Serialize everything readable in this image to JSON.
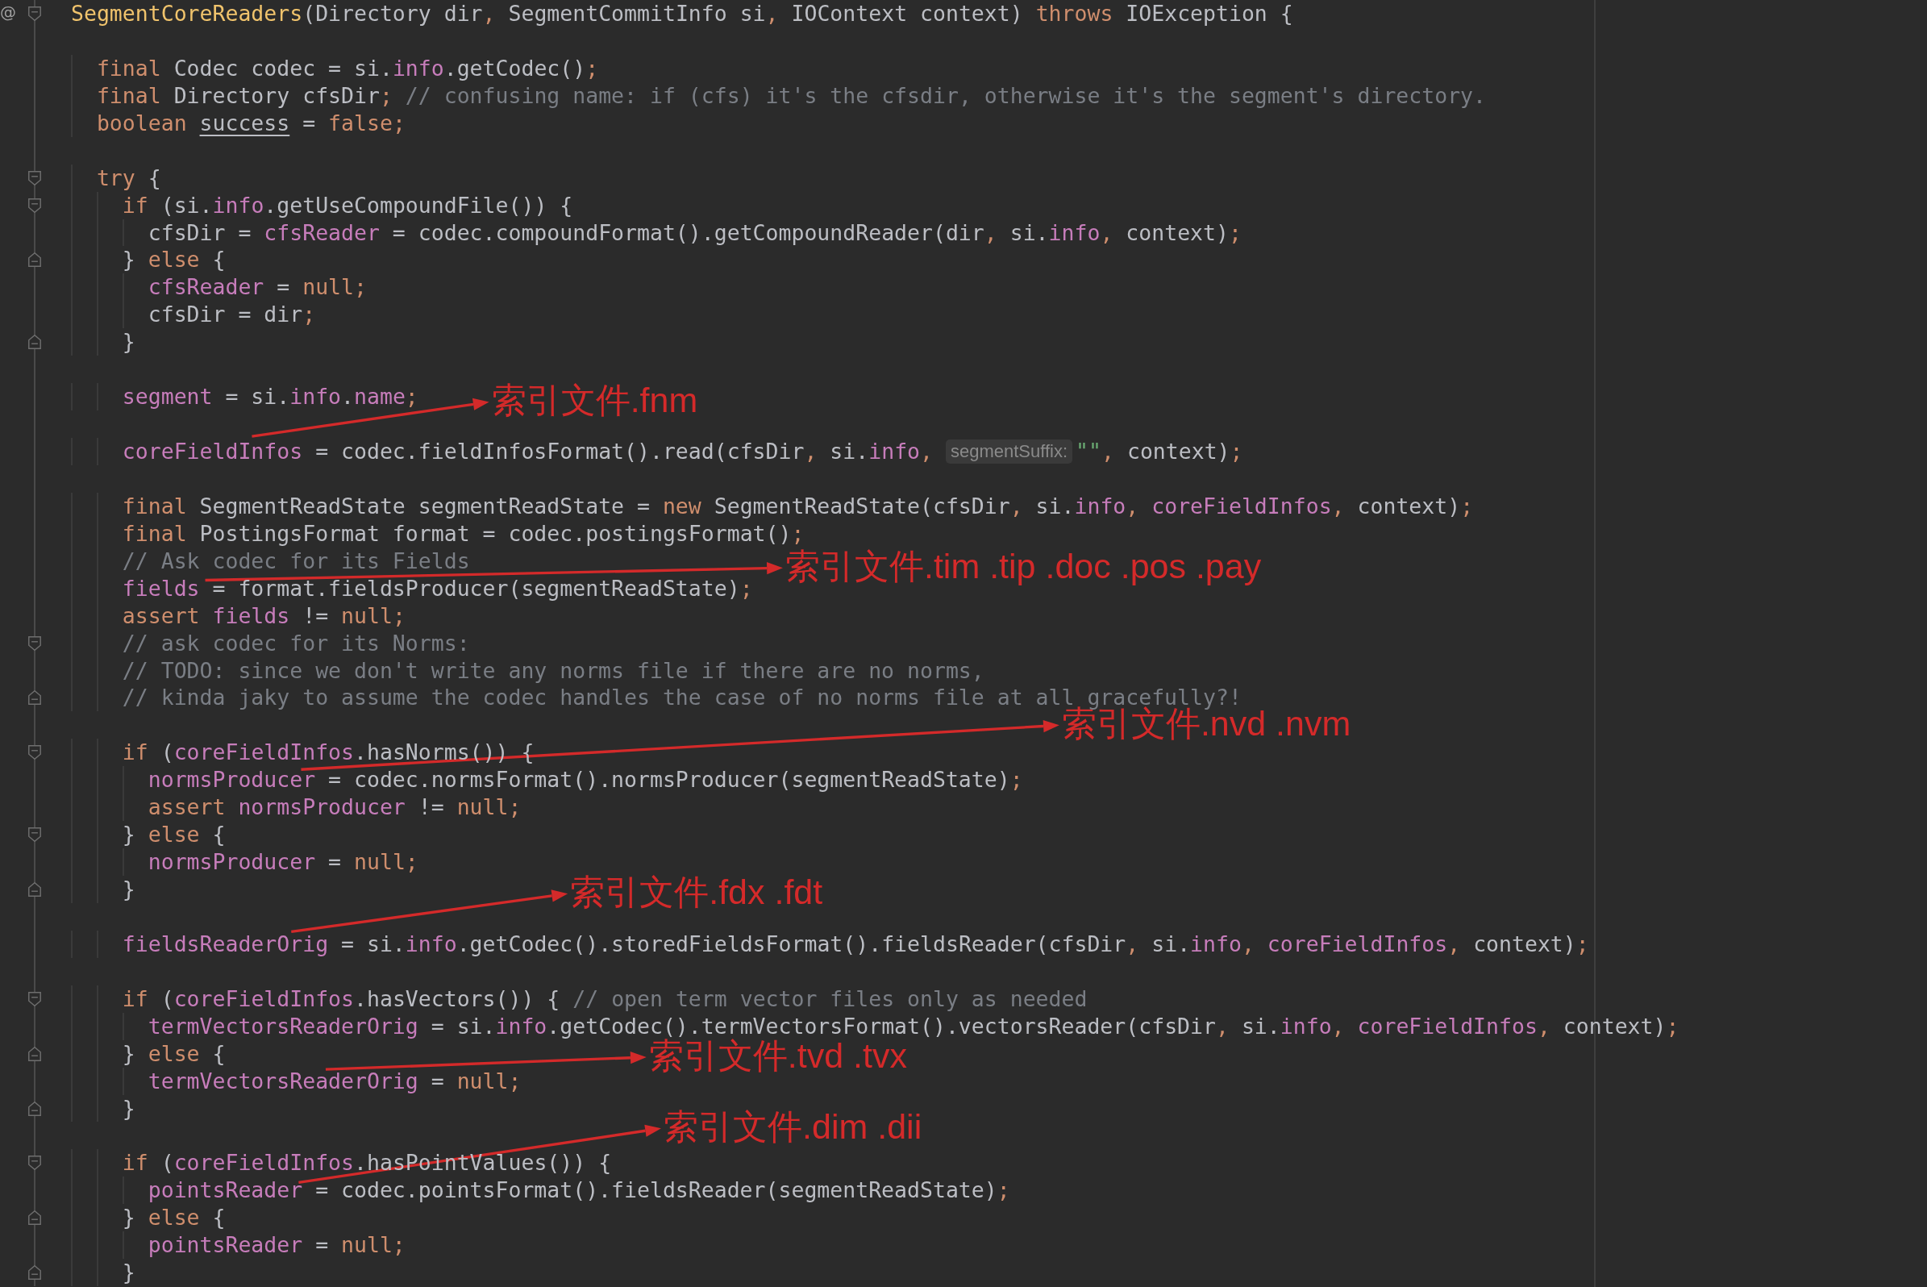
{
  "editor": {
    "lines": [
      {
        "kind": "code",
        "gutter_mark": "@",
        "fold_marker": {
          "kind": "start"
        },
        "tokens": [
          {
            "text": "SegmentCoreReaders",
            "kind": "method"
          },
          {
            "text": "(Directory dir",
            "kind": "plain"
          },
          {
            "text": ", ",
            "kind": "punct"
          },
          {
            "text": "SegmentCommitInfo si",
            "kind": "plain"
          },
          {
            "text": ", ",
            "kind": "punct"
          },
          {
            "text": "IOContext context) ",
            "kind": "plain"
          },
          {
            "text": "throws",
            "kind": "keyword"
          },
          {
            "text": " IOException {",
            "kind": "plain"
          }
        ]
      },
      {
        "kind": "blank"
      },
      {
        "kind": "code",
        "tokens": [
          {
            "text": "  final",
            "kind": "keyword"
          },
          {
            "text": " Codec codec = si.",
            "kind": "plain"
          },
          {
            "text": "info",
            "kind": "field"
          },
          {
            "text": ".getCodec()",
            "kind": "plain"
          },
          {
            "text": ";",
            "kind": "punct"
          }
        ]
      },
      {
        "kind": "code",
        "tokens": [
          {
            "text": "  final",
            "kind": "keyword"
          },
          {
            "text": " Directory cfsDir",
            "kind": "plain"
          },
          {
            "text": ";",
            "kind": "punct"
          },
          {
            "text": " // confusing name: if (cfs) it's the cfsdir, otherwise it's the segment's directory.",
            "kind": "comment"
          }
        ]
      },
      {
        "kind": "code",
        "tokens": [
          {
            "text": "  boolean ",
            "kind": "keyword"
          },
          {
            "text": "success",
            "kind": "underlined"
          },
          {
            "text": " = ",
            "kind": "plain"
          },
          {
            "text": "false;",
            "kind": "keyword"
          }
        ]
      },
      {
        "kind": "blank"
      },
      {
        "kind": "code",
        "fold_marker": {
          "kind": "start"
        },
        "tokens": [
          {
            "text": "  try",
            "kind": "keyword"
          },
          {
            "text": " {",
            "kind": "plain"
          }
        ]
      },
      {
        "kind": "code",
        "fold_marker": {
          "kind": "start"
        },
        "tokens": [
          {
            "text": "    if",
            "kind": "keyword"
          },
          {
            "text": " (si.",
            "kind": "plain"
          },
          {
            "text": "info",
            "kind": "field"
          },
          {
            "text": ".getUseCompoundFile()) {",
            "kind": "plain"
          }
        ]
      },
      {
        "kind": "code",
        "tokens": [
          {
            "text": "      cfsDir = ",
            "kind": "plain"
          },
          {
            "text": "cfsReader",
            "kind": "field"
          },
          {
            "text": " = codec.compoundFormat().getCompoundReader(dir",
            "kind": "plain"
          },
          {
            "text": ", ",
            "kind": "punct"
          },
          {
            "text": "si.",
            "kind": "plain"
          },
          {
            "text": "info",
            "kind": "field"
          },
          {
            "text": ", ",
            "kind": "punct"
          },
          {
            "text": "context)",
            "kind": "plain"
          },
          {
            "text": ";",
            "kind": "punct"
          }
        ]
      },
      {
        "kind": "code",
        "fold_marker": {
          "kind": "end"
        },
        "tokens": [
          {
            "text": "    } ",
            "kind": "plain"
          },
          {
            "text": "else",
            "kind": "keyword"
          },
          {
            "text": " {",
            "kind": "plain"
          }
        ]
      },
      {
        "kind": "code",
        "tokens": [
          {
            "text": "      cfsReader",
            "kind": "field"
          },
          {
            "text": " = ",
            "kind": "plain"
          },
          {
            "text": "null;",
            "kind": "keyword"
          }
        ]
      },
      {
        "kind": "code",
        "tokens": [
          {
            "text": "      cfsDir = dir",
            "kind": "plain"
          },
          {
            "text": ";",
            "kind": "punct"
          }
        ]
      },
      {
        "kind": "code",
        "fold_marker": {
          "kind": "end"
        },
        "tokens": [
          {
            "text": "    }",
            "kind": "plain"
          }
        ]
      },
      {
        "kind": "blank"
      },
      {
        "kind": "code",
        "tokens": [
          {
            "text": "    segment",
            "kind": "field"
          },
          {
            "text": " = si.",
            "kind": "plain"
          },
          {
            "text": "info",
            "kind": "field"
          },
          {
            "text": ".",
            "kind": "plain"
          },
          {
            "text": "name",
            "kind": "field"
          },
          {
            "text": ";",
            "kind": "punct"
          }
        ]
      },
      {
        "kind": "blank"
      },
      {
        "kind": "code",
        "tokens": [
          {
            "text": "    coreFieldInfos",
            "kind": "field"
          },
          {
            "text": " = codec.fieldInfosFormat().read(cfsDir",
            "kind": "plain"
          },
          {
            "text": ", ",
            "kind": "punct"
          },
          {
            "text": "si.",
            "kind": "plain"
          },
          {
            "text": "info",
            "kind": "field"
          },
          {
            "text": ", ",
            "kind": "punct"
          },
          {
            "text": "segmentSuffix:",
            "kind": "hint"
          },
          {
            "text": "\"\"",
            "kind": "string"
          },
          {
            "text": ", ",
            "kind": "punct"
          },
          {
            "text": "context)",
            "kind": "plain"
          },
          {
            "text": ";",
            "kind": "punct"
          }
        ]
      },
      {
        "kind": "blank"
      },
      {
        "kind": "code",
        "tokens": [
          {
            "text": "    final",
            "kind": "keyword"
          },
          {
            "text": " SegmentReadState segmentReadState = ",
            "kind": "plain"
          },
          {
            "text": "new",
            "kind": "keyword"
          },
          {
            "text": " SegmentReadState(cfsDir",
            "kind": "plain"
          },
          {
            "text": ", ",
            "kind": "punct"
          },
          {
            "text": "si.",
            "kind": "plain"
          },
          {
            "text": "info",
            "kind": "field"
          },
          {
            "text": ", ",
            "kind": "punct"
          },
          {
            "text": "coreFieldInfos",
            "kind": "field"
          },
          {
            "text": ", ",
            "kind": "punct"
          },
          {
            "text": "context)",
            "kind": "plain"
          },
          {
            "text": ";",
            "kind": "punct"
          }
        ]
      },
      {
        "kind": "code",
        "tokens": [
          {
            "text": "    final",
            "kind": "keyword"
          },
          {
            "text": " PostingsFormat format = codec.postingsFormat()",
            "kind": "plain"
          },
          {
            "text": ";",
            "kind": "punct"
          }
        ]
      },
      {
        "kind": "code",
        "tokens": [
          {
            "text": "    // Ask codec for its Fields",
            "kind": "comment"
          }
        ]
      },
      {
        "kind": "code",
        "tokens": [
          {
            "text": "    fields",
            "kind": "field"
          },
          {
            "text": " = format.fieldsProducer(segmentReadState)",
            "kind": "plain"
          },
          {
            "text": ";",
            "kind": "punct"
          }
        ]
      },
      {
        "kind": "code",
        "tokens": [
          {
            "text": "    assert ",
            "kind": "keyword"
          },
          {
            "text": "fields",
            "kind": "field"
          },
          {
            "text": " != ",
            "kind": "plain"
          },
          {
            "text": "null;",
            "kind": "keyword"
          }
        ]
      },
      {
        "kind": "code",
        "fold_marker": {
          "kind": "start"
        },
        "tokens": [
          {
            "text": "    // ask codec for its Norms:",
            "kind": "comment"
          }
        ]
      },
      {
        "kind": "code",
        "tokens": [
          {
            "text": "    // TODO: since we don't write any norms file if there are no norms,",
            "kind": "comment"
          }
        ]
      },
      {
        "kind": "code",
        "fold_marker": {
          "kind": "end"
        },
        "tokens": [
          {
            "text": "    // kinda jaky to assume the codec handles the case of no norms file at all gracefully?!",
            "kind": "comment"
          }
        ]
      },
      {
        "kind": "blank"
      },
      {
        "kind": "code",
        "fold_marker": {
          "kind": "start"
        },
        "tokens": [
          {
            "text": "    if",
            "kind": "keyword"
          },
          {
            "text": " (",
            "kind": "plain"
          },
          {
            "text": "coreFieldInfos",
            "kind": "field"
          },
          {
            "text": ".hasNorms()) {",
            "kind": "plain"
          }
        ]
      },
      {
        "kind": "code",
        "tokens": [
          {
            "text": "      normsProducer",
            "kind": "field"
          },
          {
            "text": " = codec.normsFormat().normsProducer(segmentReadState)",
            "kind": "plain"
          },
          {
            "text": ";",
            "kind": "punct"
          }
        ]
      },
      {
        "kind": "code",
        "tokens": [
          {
            "text": "      assert ",
            "kind": "keyword"
          },
          {
            "text": "normsProducer",
            "kind": "field"
          },
          {
            "text": " != ",
            "kind": "plain"
          },
          {
            "text": "null;",
            "kind": "keyword"
          }
        ]
      },
      {
        "kind": "code",
        "fold_marker": {
          "kind": "start"
        },
        "tokens": [
          {
            "text": "    } ",
            "kind": "plain"
          },
          {
            "text": "else",
            "kind": "keyword"
          },
          {
            "text": " {",
            "kind": "plain"
          }
        ]
      },
      {
        "kind": "code",
        "tokens": [
          {
            "text": "      normsProducer",
            "kind": "field"
          },
          {
            "text": " = ",
            "kind": "plain"
          },
          {
            "text": "null;",
            "kind": "keyword"
          }
        ]
      },
      {
        "kind": "code",
        "fold_marker": {
          "kind": "end"
        },
        "tokens": [
          {
            "text": "    }",
            "kind": "plain"
          }
        ]
      },
      {
        "kind": "blank"
      },
      {
        "kind": "code",
        "tokens": [
          {
            "text": "    fieldsReaderOrig",
            "kind": "field"
          },
          {
            "text": " = si.",
            "kind": "plain"
          },
          {
            "text": "info",
            "kind": "field"
          },
          {
            "text": ".getCodec().storedFieldsFormat().fieldsReader(cfsDir",
            "kind": "plain"
          },
          {
            "text": ", ",
            "kind": "punct"
          },
          {
            "text": "si.",
            "kind": "plain"
          },
          {
            "text": "info",
            "kind": "field"
          },
          {
            "text": ", ",
            "kind": "punct"
          },
          {
            "text": "coreFieldInfos",
            "kind": "field"
          },
          {
            "text": ", ",
            "kind": "punct"
          },
          {
            "text": "context)",
            "kind": "plain"
          },
          {
            "text": ";",
            "kind": "punct"
          }
        ]
      },
      {
        "kind": "blank"
      },
      {
        "kind": "code",
        "fold_marker": {
          "kind": "start"
        },
        "tokens": [
          {
            "text": "    if",
            "kind": "keyword"
          },
          {
            "text": " (",
            "kind": "plain"
          },
          {
            "text": "coreFieldInfos",
            "kind": "field"
          },
          {
            "text": ".hasVectors()) { ",
            "kind": "plain"
          },
          {
            "text": "// open term vector files only as needed",
            "kind": "comment"
          }
        ]
      },
      {
        "kind": "code",
        "tokens": [
          {
            "text": "      termVectorsReaderOrig",
            "kind": "field"
          },
          {
            "text": " = si.",
            "kind": "plain"
          },
          {
            "text": "info",
            "kind": "field"
          },
          {
            "text": ".getCodec().termVectorsFormat().vectorsReader(cfsDir",
            "kind": "plain"
          },
          {
            "text": ", ",
            "kind": "punct"
          },
          {
            "text": "si.",
            "kind": "plain"
          },
          {
            "text": "info",
            "kind": "field"
          },
          {
            "text": ", ",
            "kind": "punct"
          },
          {
            "text": "coreFieldInfos",
            "kind": "field"
          },
          {
            "text": ", ",
            "kind": "punct"
          },
          {
            "text": "context)",
            "kind": "plain"
          },
          {
            "text": ";",
            "kind": "punct"
          }
        ]
      },
      {
        "kind": "code",
        "fold_marker": {
          "kind": "end"
        },
        "tokens": [
          {
            "text": "    } ",
            "kind": "plain"
          },
          {
            "text": "else",
            "kind": "keyword"
          },
          {
            "text": " {",
            "kind": "plain"
          }
        ]
      },
      {
        "kind": "code",
        "tokens": [
          {
            "text": "      termVectorsReaderOrig",
            "kind": "field"
          },
          {
            "text": " = ",
            "kind": "plain"
          },
          {
            "text": "null;",
            "kind": "keyword"
          }
        ]
      },
      {
        "kind": "code",
        "fold_marker": {
          "kind": "end"
        },
        "tokens": [
          {
            "text": "    }",
            "kind": "plain"
          }
        ]
      },
      {
        "kind": "blank"
      },
      {
        "kind": "code",
        "fold_marker": {
          "kind": "start"
        },
        "tokens": [
          {
            "text": "    if",
            "kind": "keyword"
          },
          {
            "text": " (",
            "kind": "plain"
          },
          {
            "text": "coreFieldInfos",
            "kind": "field"
          },
          {
            "text": ".hasPointValues()) {",
            "kind": "plain"
          }
        ]
      },
      {
        "kind": "code",
        "tokens": [
          {
            "text": "      pointsReader",
            "kind": "field"
          },
          {
            "text": " = codec.pointsFormat().fieldsReader(segmentReadState)",
            "kind": "plain"
          },
          {
            "text": ";",
            "kind": "punct"
          }
        ]
      },
      {
        "kind": "code",
        "fold_marker": {
          "kind": "end"
        },
        "tokens": [
          {
            "text": "    } ",
            "kind": "plain"
          },
          {
            "text": "else",
            "kind": "keyword"
          },
          {
            "text": " {",
            "kind": "plain"
          }
        ]
      },
      {
        "kind": "code",
        "tokens": [
          {
            "text": "      pointsReader",
            "kind": "field"
          },
          {
            "text": " = ",
            "kind": "plain"
          },
          {
            "text": "null;",
            "kind": "keyword"
          }
        ]
      },
      {
        "kind": "code",
        "fold_marker": {
          "kind": "end"
        },
        "tokens": [
          {
            "text": "    }",
            "kind": "plain"
          }
        ]
      }
    ]
  },
  "annotations": [
    {
      "label": "索引文件.fnm"
    },
    {
      "label": "索引文件.tim .tip .doc .pos .pay"
    },
    {
      "label": "索引文件.nvd .nvm"
    },
    {
      "label": "索引文件.fdx .fdt"
    },
    {
      "label": "索引文件.tvd .tvx"
    },
    {
      "label": "索引文件.dim .dii"
    }
  ]
}
